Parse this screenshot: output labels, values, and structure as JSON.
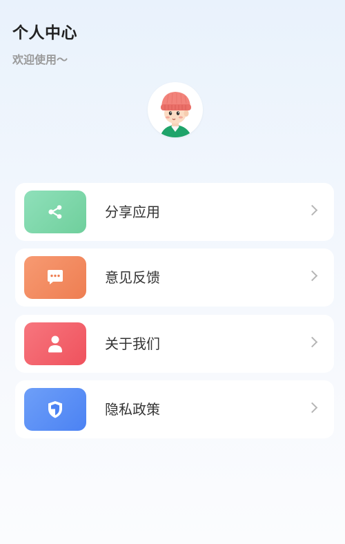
{
  "header": {
    "title": "个人中心",
    "subtitle": "欢迎使用～"
  },
  "avatar": {
    "icon": "cartoon-boy-avatar-icon"
  },
  "menu": {
    "items": [
      {
        "label": "分享应用",
        "icon": "share-icon",
        "color_start": "#8fe0ba",
        "color_end": "#6fcf9c"
      },
      {
        "label": "意见反馈",
        "icon": "feedback-icon",
        "color_start": "#f79a72",
        "color_end": "#ee7e52"
      },
      {
        "label": "关于我们",
        "icon": "user-icon",
        "color_start": "#f7767e",
        "color_end": "#ef525d"
      },
      {
        "label": "隐私政策",
        "icon": "shield-icon",
        "color_start": "#6e9ff8",
        "color_end": "#4b82f3"
      }
    ]
  }
}
